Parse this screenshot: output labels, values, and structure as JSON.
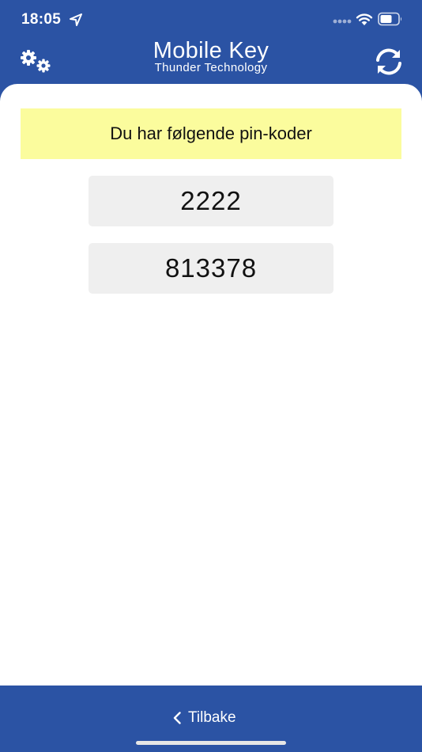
{
  "status_bar": {
    "time": "18:05",
    "location_icon": "location-arrow-icon",
    "signal_icon": "cellular-signal-icon",
    "wifi_icon": "wifi-icon",
    "battery_icon": "battery-icon"
  },
  "header": {
    "title": "Mobile Key",
    "subtitle": "Thunder Technology",
    "left_icon": "gears-icon",
    "right_icon": "refresh-icon"
  },
  "main": {
    "banner_text": "Du har følgende pin-koder",
    "pin_codes": [
      "2222",
      "813378"
    ]
  },
  "footer": {
    "back_label": "Tilbake",
    "back_icon": "chevron-left-icon"
  },
  "colors": {
    "primary": "#2b53a4",
    "banner": "#fbfc9d",
    "card": "#efefef"
  }
}
